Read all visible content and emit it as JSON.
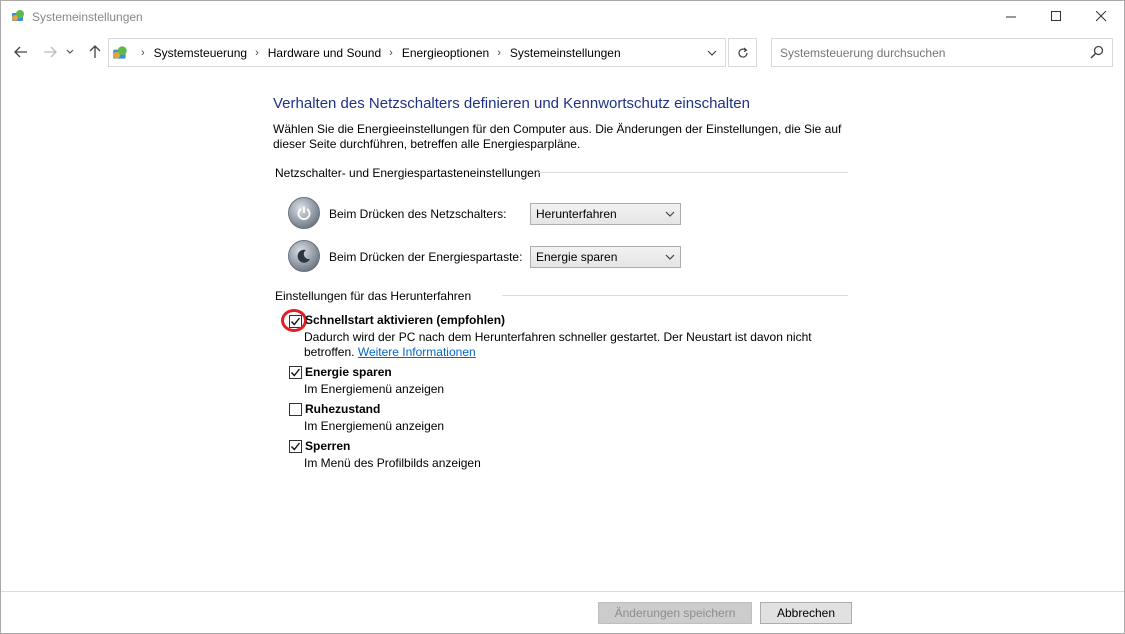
{
  "window": {
    "title": "Systemeinstellungen",
    "controls": {
      "minimize": "—",
      "maximize": "☐",
      "close": "✕"
    }
  },
  "address_bar": {
    "breadcrumbs": [
      "Systemsteuerung",
      "Hardware und Sound",
      "Energieoptionen",
      "Systemeinstellungen"
    ],
    "separator": "›"
  },
  "search": {
    "placeholder": "Systemsteuerung durchsuchen"
  },
  "page": {
    "title": "Verhalten des Netzschalters definieren und Kennwortschutz einschalten",
    "description": "Wählen Sie die Energieeinstellungen für den Computer aus. Die Änderungen der Einstellungen, die Sie auf dieser Seite durchführen, betreffen alle Energiesparpläne."
  },
  "power_section": {
    "heading": "Netzschalter- und Energiespartasteneinstellungen",
    "power_button": {
      "label": "Beim Drücken des Netzschalters:",
      "value": "Herunterfahren"
    },
    "sleep_button": {
      "label": "Beim Drücken der Energiespartaste:",
      "value": "Energie sparen"
    }
  },
  "shutdown_section": {
    "heading": "Einstellungen für das Herunterfahren",
    "fast_startup": {
      "label": "Schnellstart aktivieren (empfohlen)",
      "desc": "Dadurch wird der PC nach dem Herunterfahren schneller gestartet. Der Neustart ist davon nicht betroffen.",
      "link": "Weitere Informationen",
      "checked": true
    },
    "sleep": {
      "label": "Energie sparen",
      "desc": "Im Energiemenü anzeigen",
      "checked": true
    },
    "hibernate": {
      "label": "Ruhezustand",
      "desc": "Im Energiemenü anzeigen",
      "checked": false
    },
    "lock": {
      "label": "Sperren",
      "desc": "Im Menü des Profilbilds anzeigen",
      "checked": true
    }
  },
  "buttons": {
    "save": "Änderungen speichern",
    "cancel": "Abbrechen"
  },
  "colors": {
    "title_blue": "#1e3287",
    "link_blue": "#0066cc",
    "highlight_red": "#e31e24"
  }
}
